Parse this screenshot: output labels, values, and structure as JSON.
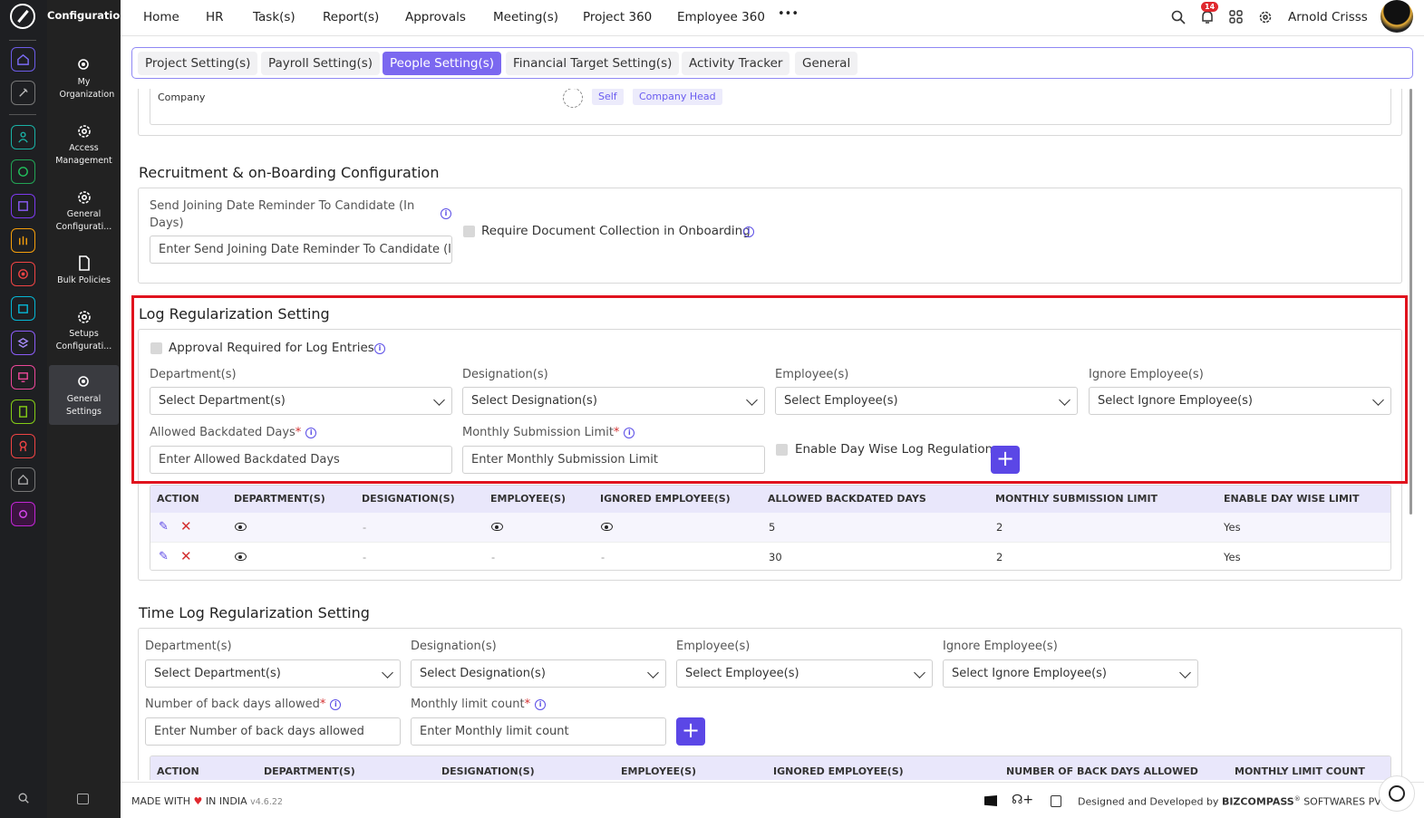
{
  "sidebar": {
    "title": "Configuration",
    "items": [
      {
        "label": "My Organization"
      },
      {
        "label": "Access Management"
      },
      {
        "label": "General Configurati..."
      },
      {
        "label": "Bulk Policies"
      },
      {
        "label": "Setups Configurati..."
      },
      {
        "label": "General Settings"
      }
    ]
  },
  "topnav": {
    "items": [
      "Home",
      "HR",
      "Task(s)",
      "Report(s)",
      "Approvals",
      "Meeting(s)",
      "Project 360",
      "Employee 360",
      "•••"
    ],
    "notif_count": "14",
    "user": "Arnold Crisss"
  },
  "tabs": [
    "Project Setting(s)",
    "Payroll Setting(s)",
    "People Setting(s)",
    "Financial Target Setting(s)",
    "Activity Tracker",
    "General"
  ],
  "company_row": {
    "label": "Company",
    "tags": [
      "Self",
      "Company Head"
    ]
  },
  "recruit": {
    "title": "Recruitment & on-Boarding Configuration",
    "reminder_label": "Send Joining Date Reminder To Candidate (In Days)",
    "reminder_placeholder": "Enter Send Joining Date Reminder To Candidate (In ...",
    "doc_label": "Require Document Collection in Onboarding"
  },
  "logreg": {
    "title": "Log Regularization Setting",
    "approval_label": "Approval Required for Log Entries",
    "dept_label": "Department(s)",
    "dept_value": "Select Department(s)",
    "desig_label": "Designation(s)",
    "desig_value": "Select Designation(s)",
    "emp_label": "Employee(s)",
    "emp_value": "Select Employee(s)",
    "ignore_label": "Ignore Employee(s)",
    "ignore_value": "Select Ignore Employee(s)",
    "backdated_label": "Allowed Backdated Days",
    "backdated_placeholder": "Enter Allowed Backdated Days",
    "monthly_label": "Monthly Submission Limit",
    "monthly_placeholder": "Enter Monthly Submission Limit",
    "daywise_label": "Enable Day Wise Log Regulation",
    "columns": [
      "ACTION",
      "DEPARTMENT(S)",
      "DESIGNATION(S)",
      "EMPLOYEE(S)",
      "IGNORED EMPLOYEE(S)",
      "ALLOWED BACKDATED DAYS",
      "MONTHLY SUBMISSION LIMIT",
      "ENABLE DAY WISE LIMIT"
    ],
    "rows": [
      {
        "designation": "-",
        "employee": "eye",
        "ignored": "eye",
        "backdated": "5",
        "monthly": "2",
        "daywise": "Yes"
      },
      {
        "designation": "-",
        "employee": "-",
        "ignored": "-",
        "backdated": "30",
        "monthly": "2",
        "daywise": "Yes"
      }
    ]
  },
  "timelog": {
    "title": "Time Log Regularization Setting",
    "dept_label": "Department(s)",
    "dept_value": "Select Department(s)",
    "desig_label": "Designation(s)",
    "desig_value": "Select Designation(s)",
    "emp_label": "Employee(s)",
    "emp_value": "Select Employee(s)",
    "ignore_label": "Ignore Employee(s)",
    "ignore_value": "Select Ignore Employee(s)",
    "back_label": "Number of back days allowed",
    "back_placeholder": "Enter Number of back days allowed",
    "limit_label": "Monthly limit count",
    "limit_placeholder": "Enter Monthly limit count",
    "columns": [
      "ACTION",
      "DEPARTMENT(S)",
      "DESIGNATION(S)",
      "EMPLOYEE(S)",
      "IGNORED EMPLOYEE(S)",
      "NUMBER OF BACK DAYS ALLOWED",
      "MONTHLY LIMIT COUNT"
    ]
  },
  "footer": {
    "made": "MADE WITH",
    "india": "IN INDIA",
    "version": "v4.6.22",
    "designed": "Designed and Developed by",
    "company": "BIZCOMPASS",
    "company_rest": "SOFTWARES PVT"
  },
  "colors": {
    "accent": "#5b47e6",
    "highlight": "#e0131e",
    "heart": "#e0282e"
  }
}
